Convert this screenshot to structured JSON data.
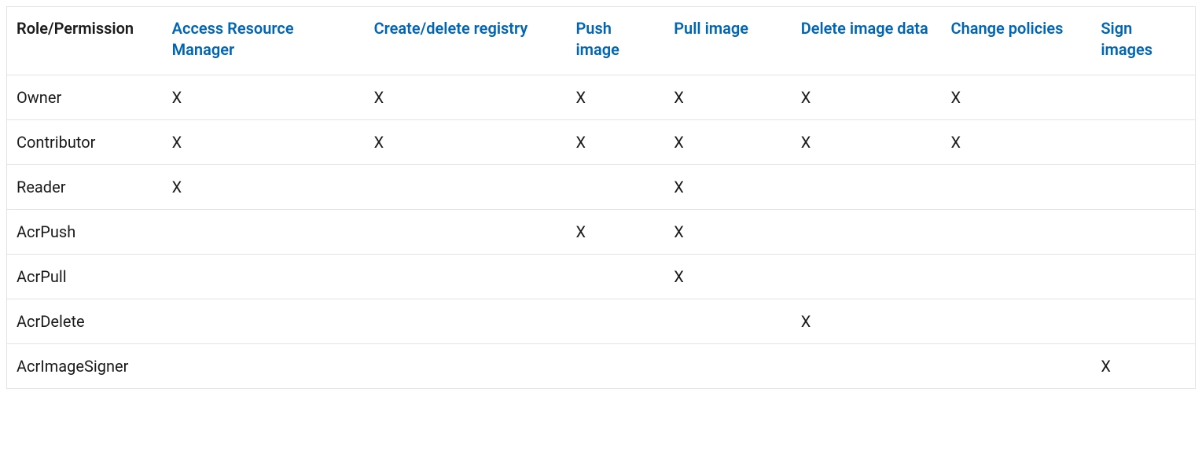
{
  "table": {
    "mark": "X",
    "headers": [
      {
        "label": "Role/Permission",
        "link": false
      },
      {
        "label": "Access Resource Manager",
        "link": true
      },
      {
        "label": "Create/delete registry",
        "link": true
      },
      {
        "label": "Push image",
        "link": true
      },
      {
        "label": "Pull image",
        "link": true
      },
      {
        "label": "Delete image data",
        "link": true
      },
      {
        "label": "Change policies",
        "link": true
      },
      {
        "label": "Sign images",
        "link": true
      }
    ],
    "rows": [
      {
        "role": "Owner",
        "perms": [
          true,
          true,
          true,
          true,
          true,
          true,
          false
        ]
      },
      {
        "role": "Contributor",
        "perms": [
          true,
          true,
          true,
          true,
          true,
          true,
          false
        ]
      },
      {
        "role": "Reader",
        "perms": [
          true,
          false,
          false,
          true,
          false,
          false,
          false
        ]
      },
      {
        "role": "AcrPush",
        "perms": [
          false,
          false,
          true,
          true,
          false,
          false,
          false
        ]
      },
      {
        "role": "AcrPull",
        "perms": [
          false,
          false,
          false,
          true,
          false,
          false,
          false
        ]
      },
      {
        "role": "AcrDelete",
        "perms": [
          false,
          false,
          false,
          false,
          true,
          false,
          false
        ]
      },
      {
        "role": "AcrImageSigner",
        "perms": [
          false,
          false,
          false,
          false,
          false,
          false,
          true
        ]
      }
    ]
  }
}
